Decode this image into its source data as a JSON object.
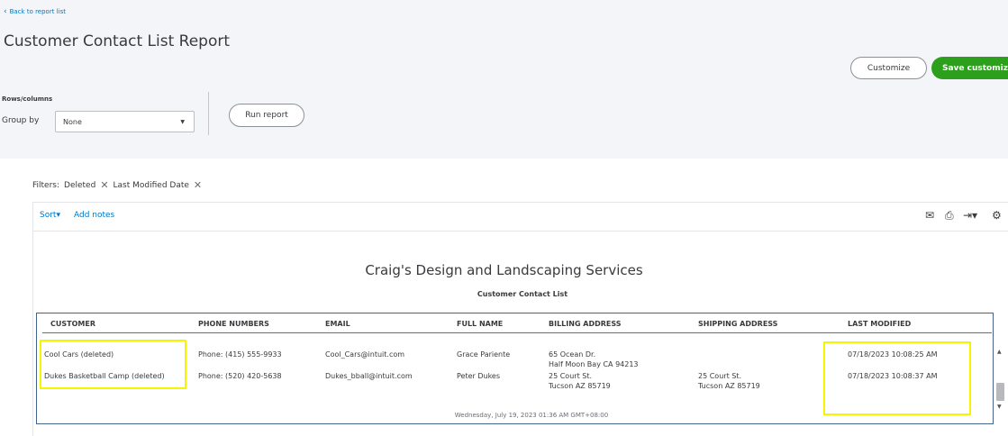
{
  "nav": {
    "back_label": "Back to report list"
  },
  "header": {
    "title": "Customer Contact List Report",
    "customize_label": "Customize",
    "save_label": "Save customiz"
  },
  "controls": {
    "rows_columns_label": "Rows/columns",
    "group_by_label": "Group by",
    "group_by_value": "None",
    "run_report_label": "Run report"
  },
  "filters": {
    "label": "Filters:",
    "items": [
      "Deleted",
      "Last Modified Date"
    ]
  },
  "toolbar": {
    "sort_label": "Sort",
    "add_notes_label": "Add notes"
  },
  "report": {
    "company": "Craig's Design and Landscaping Services",
    "name": "Customer Contact List",
    "columns": [
      "CUSTOMER",
      "PHONE NUMBERS",
      "EMAIL",
      "FULL NAME",
      "BILLING ADDRESS",
      "SHIPPING ADDRESS",
      "LAST MODIFIED"
    ],
    "rows": [
      {
        "customer": "Cool Cars (deleted)",
        "phone": "Phone: (415) 555-9933",
        "email": "Cool_Cars@intuit.com",
        "full_name": "Grace Pariente",
        "billing_1": "65 Ocean Dr.",
        "billing_2": "Half Moon Bay CA 94213",
        "shipping_1": "",
        "shipping_2": "",
        "last_modified": "07/18/2023 10:08:25 AM"
      },
      {
        "customer": "Dukes Basketball Camp (deleted)",
        "phone": "Phone: (520) 420-5638",
        "email": "Dukes_bball@intuit.com",
        "full_name": "Peter Dukes",
        "billing_1": "25 Court St.",
        "billing_2": "Tucson AZ 85719",
        "shipping_1": "25 Court St.",
        "shipping_2": "Tucson AZ 85719",
        "last_modified": "07/18/2023 10:08:37 AM"
      }
    ],
    "footer": "Wednesday, July 19, 2023  01:36 AM GMT+08:00"
  },
  "colors": {
    "link": "#0077c5",
    "primary_button": "#2ca01c",
    "highlight": "#f5f500",
    "table_border": "#44628e"
  },
  "icons": [
    "chevron-left-icon",
    "caret-down-icon",
    "close-icon",
    "email-icon",
    "print-icon",
    "export-icon",
    "gear-icon"
  ]
}
